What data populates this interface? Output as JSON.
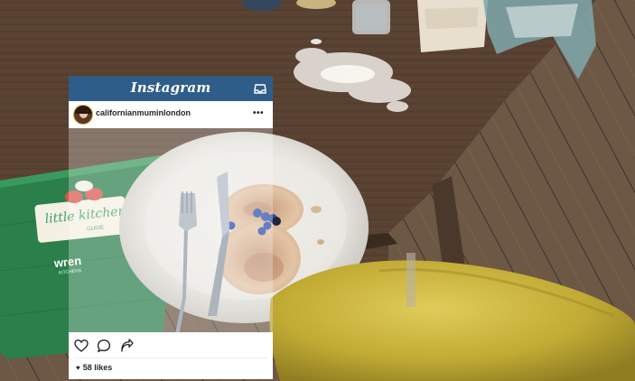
{
  "app": {
    "title": "Instagram"
  },
  "post": {
    "username": "californianmuminlondon",
    "more_glyph": "•••",
    "likes_heart": "♥",
    "likes": "58 likes"
  },
  "book": {
    "line1": "little kitchen",
    "line2": "GUIDE",
    "brand": "wren",
    "brand_sub": "KITCHENS"
  },
  "icons": {
    "inbox": "inbox-icon",
    "heart": "heart-icon",
    "comment": "comment-icon",
    "share": "share-icon"
  },
  "colors": {
    "header_blue": "#2f5d8a",
    "book_green": "#2d8a52",
    "chair_yellow": "#c9b43c",
    "table_wood": "#5a4333",
    "floor_wood": "#6f5a48"
  }
}
